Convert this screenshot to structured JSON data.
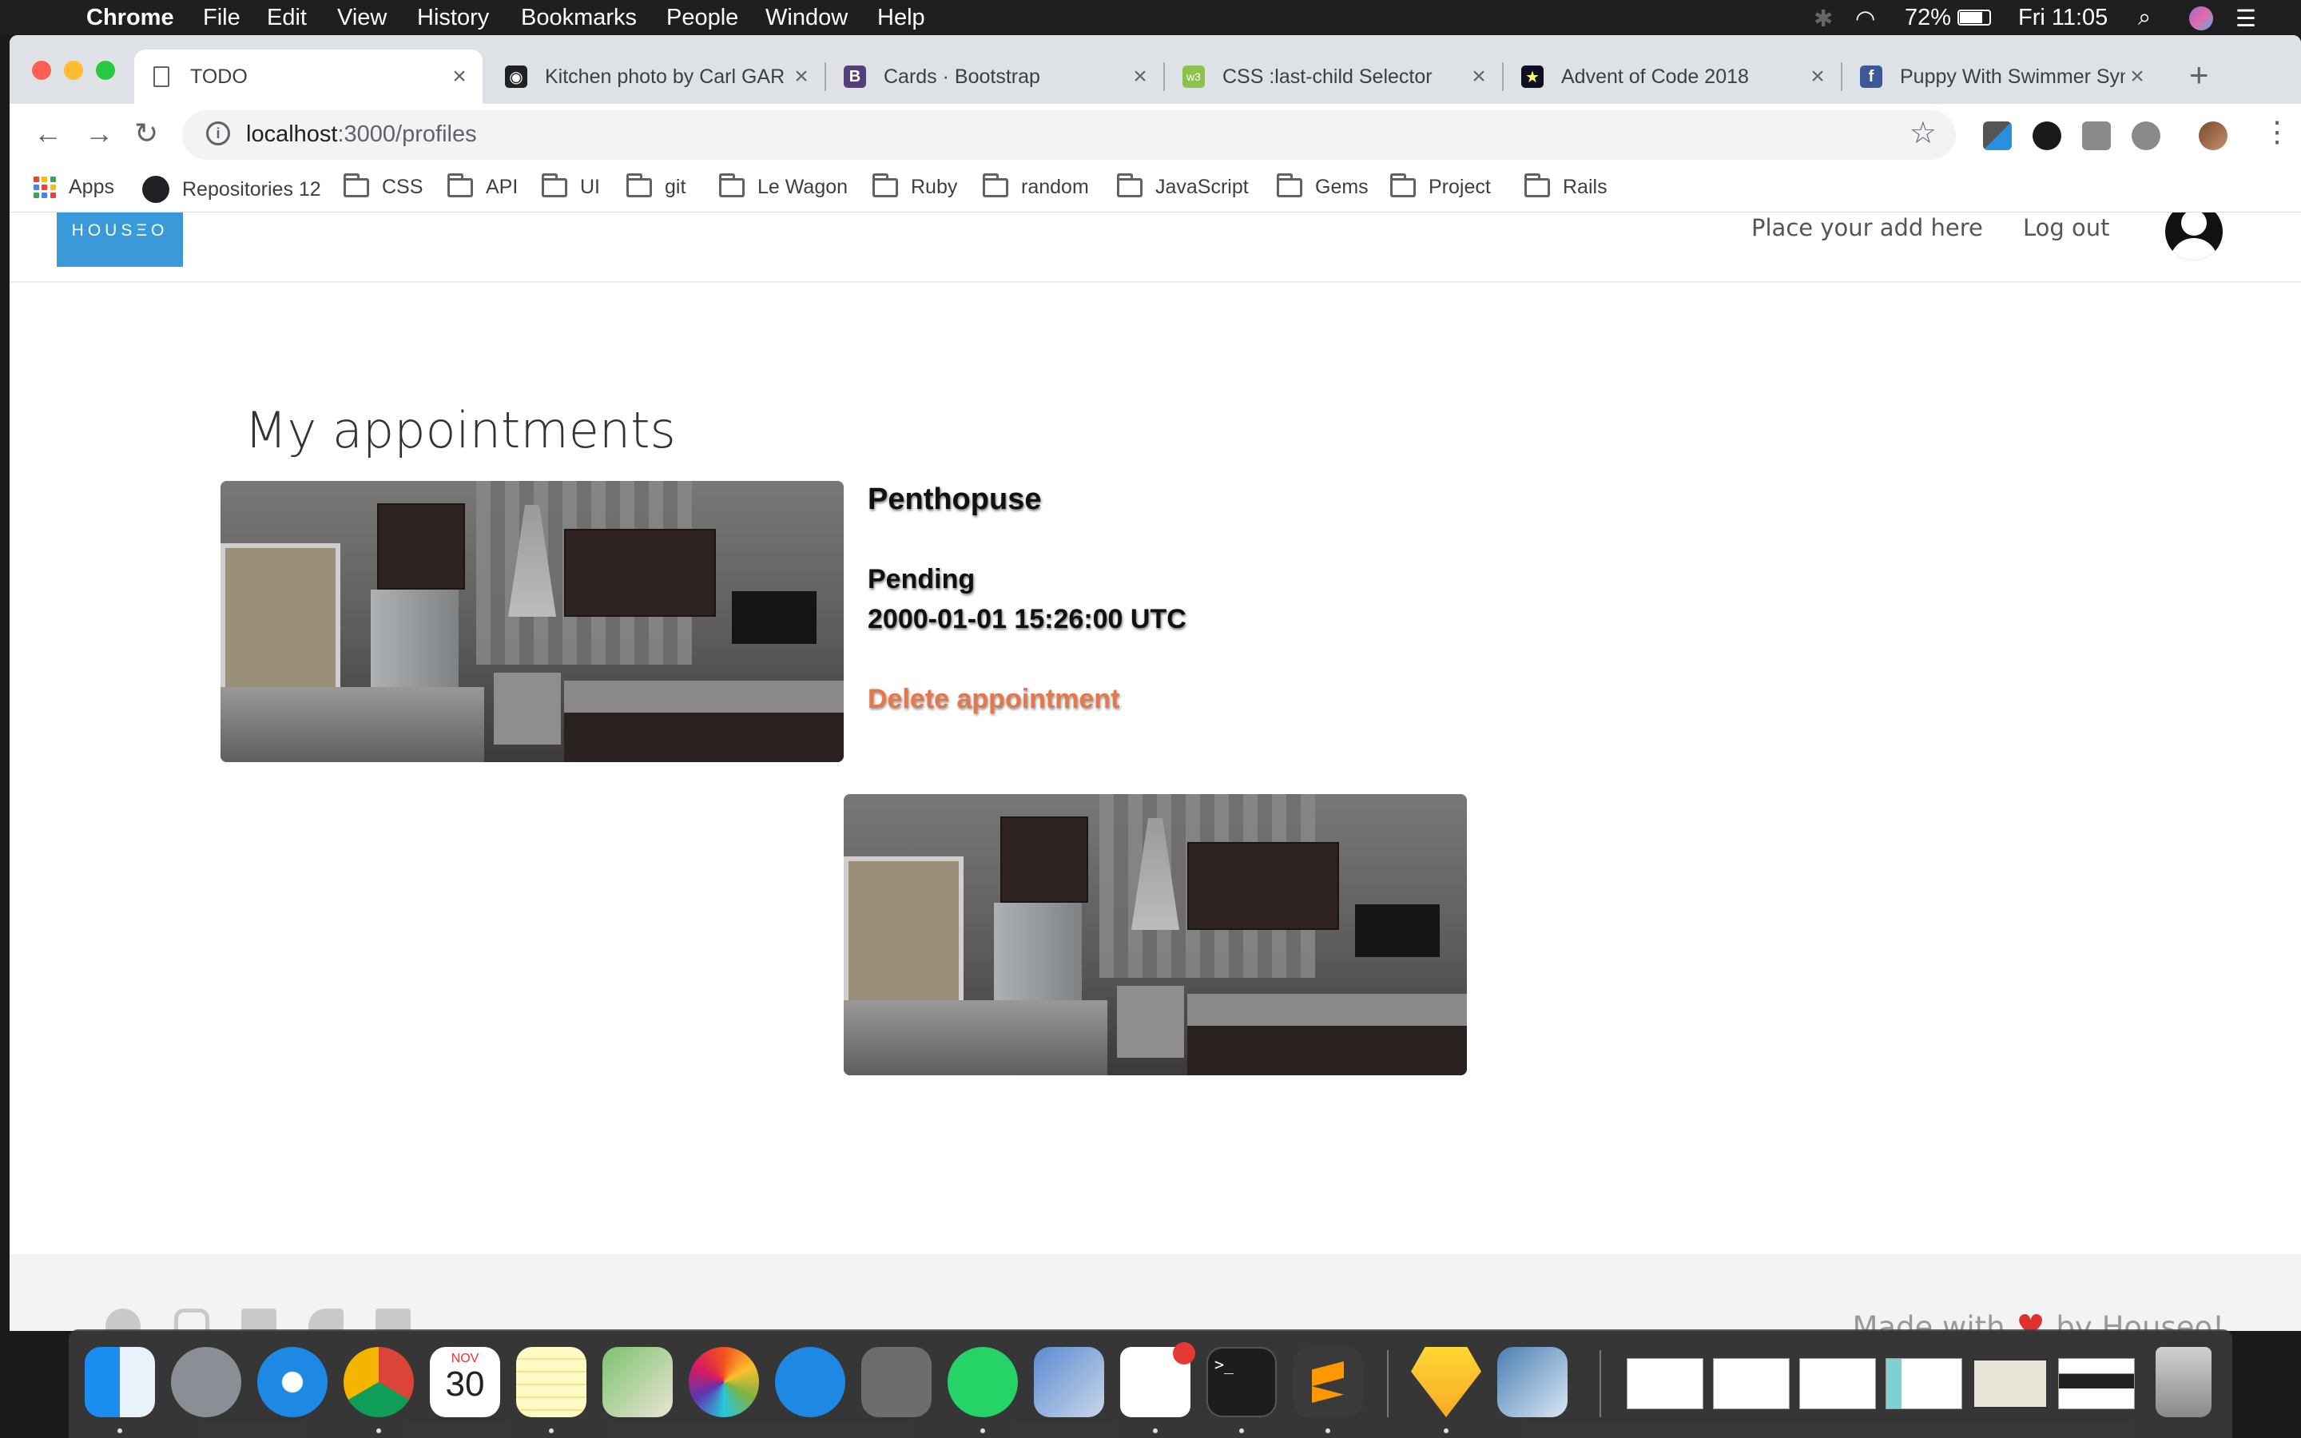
{
  "menubar": {
    "app_name": "Chrome",
    "menus": [
      "File",
      "Edit",
      "View",
      "History",
      "Bookmarks",
      "People",
      "Window",
      "Help"
    ],
    "battery": "72%",
    "clock": "Fri 11:05"
  },
  "tabs": [
    {
      "title": "TODO",
      "active": true
    },
    {
      "title": "Kitchen photo by Carl GAR"
    },
    {
      "title": "Cards · Bootstrap"
    },
    {
      "title": "CSS :last-child Selector"
    },
    {
      "title": "Advent of Code 2018"
    },
    {
      "title": "Puppy With Swimmer Syn"
    }
  ],
  "newtab_label": "+",
  "omnibox": {
    "host": "localhost",
    "path": ":3000/profiles"
  },
  "bookmarks": {
    "apps": "Apps",
    "repos": "Repositories 12",
    "folders": [
      "CSS",
      "API",
      "UI",
      "git",
      "Le Wagon",
      "Ruby",
      "random",
      "JavaScript",
      "Gems",
      "Project",
      "Rails"
    ]
  },
  "site": {
    "logo": "HOUSΞO",
    "nav": {
      "place_ad": "Place your add here",
      "logout": "Log out"
    },
    "page_title": "My appointments",
    "appointments": [
      {
        "property": "Penthopuse",
        "status": "Pending",
        "datetime": "2000-01-01 15:26:00 UTC",
        "delete_label": "Delete appointment"
      }
    ],
    "footer": {
      "made_prefix": "Made with",
      "made_suffix": "by Houseo!",
      "social": [
        "github-icon",
        "instagram-icon",
        "facebook-icon",
        "twitter-icon",
        "linkedin-icon"
      ]
    }
  },
  "dock": {
    "calendar_month": "NOV",
    "calendar_day": "30",
    "terminal_prompt": ">_"
  },
  "colors": {
    "logo_bg": "#3a9ad9",
    "delete_link": "#e5784a",
    "heart": "#e0312e"
  }
}
